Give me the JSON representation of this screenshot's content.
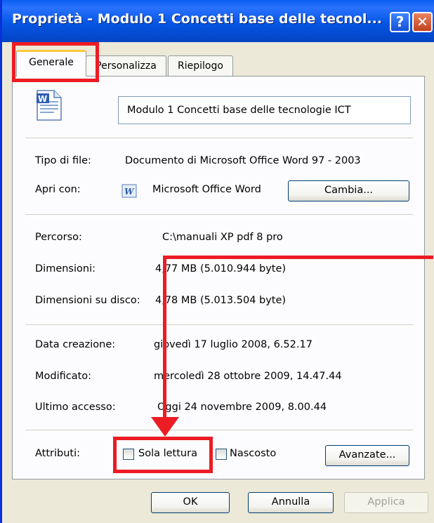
{
  "window": {
    "title": "Proprietà - Modulo 1 Concetti base delle tecnol..."
  },
  "titlebar": {
    "help_label": "?",
    "close_label": "✕"
  },
  "tabs": [
    {
      "label": "Generale"
    },
    {
      "label": "Personalizza"
    },
    {
      "label": "Riepilogo"
    }
  ],
  "file": {
    "icon": "word-document-icon",
    "name": "Modulo 1 Concetti base delle tecnologie ICT"
  },
  "details": {
    "type_label": "Tipo di file:",
    "type_value": "Documento di Microsoft Office Word 97 - 2003",
    "open_with_label": "Apri con:",
    "open_with_value": "Microsoft Office Word",
    "change_button": "Cambia...",
    "path_label": "Percorso:",
    "path_value": "C:\\manuali XP pdf 8 pro",
    "size_label": "Dimensioni:",
    "size_value": "4,77 MB (5.010.944 byte)",
    "disk_size_label": "Dimensioni su disco:",
    "disk_size_value": "4,78 MB (5.013.504 byte)",
    "created_label": "Data creazione:",
    "created_value": "giovedì 17 luglio 2008, 6.52.17",
    "modified_label": "Modificato:",
    "modified_value": "mercoledì 28 ottobre 2009, 14.47.44",
    "accessed_label": "Ultimo accesso:",
    "accessed_value": "Oggi 24 novembre 2009, 8.00.44"
  },
  "attributes": {
    "label": "Attributi:",
    "read_only": "Sola lettura",
    "hidden": "Nascosto",
    "advanced_button": "Avanzate..."
  },
  "footer": {
    "ok": "OK",
    "cancel": "Annulla",
    "apply": "Applica"
  },
  "colors": {
    "annotation": "#ec1c24",
    "title_bar": "#0655e4"
  }
}
